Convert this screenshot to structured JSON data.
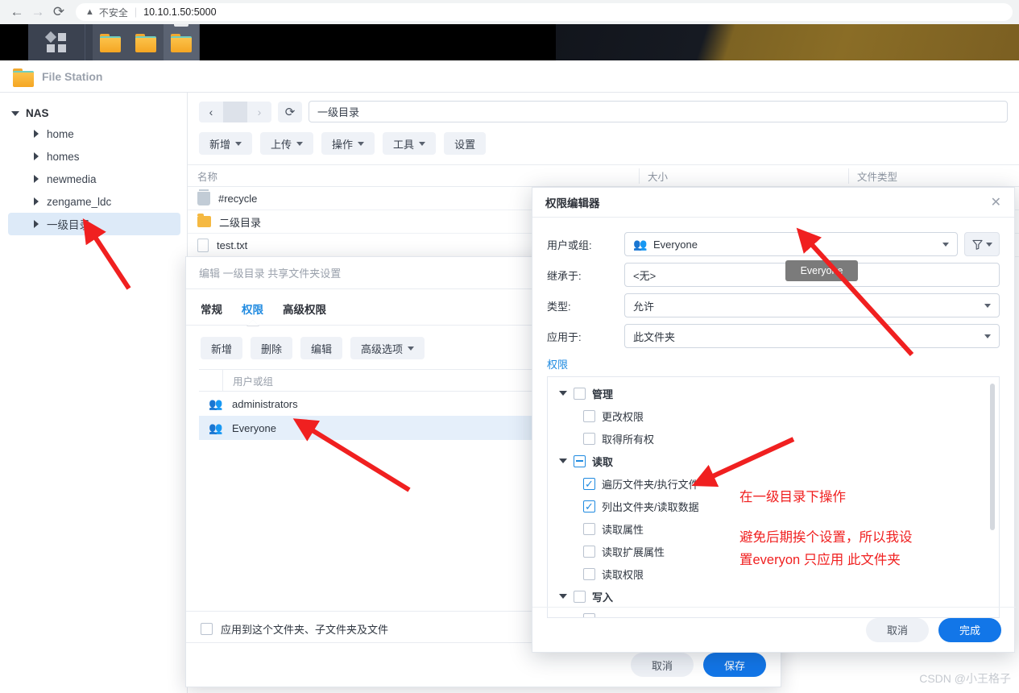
{
  "browser": {
    "back_icon": "arrow-left-icon",
    "forward_icon": "arrow-right-icon",
    "reload_icon": "reload-icon",
    "warning_icon": "warning-triangle-icon",
    "security_label": "不安全",
    "url": "10.10.1.50:5000"
  },
  "desktop": {
    "apps_icon": "app-grid-icon",
    "taskbar_items": [
      "folder-icon",
      "folder-icon",
      "folder-icon"
    ]
  },
  "file_station": {
    "title": "File Station",
    "folder_icon": "folder-icon",
    "sidebar": {
      "root": "NAS",
      "items": [
        {
          "label": "home",
          "selected": false
        },
        {
          "label": "homes",
          "selected": false
        },
        {
          "label": "newmedia",
          "selected": false
        },
        {
          "label": "zengame_ldc",
          "selected": false
        },
        {
          "label": "一级目录",
          "selected": true
        }
      ]
    },
    "nav": {
      "back_icon": "chevron-left-icon",
      "forward_icon": "chevron-right-icon",
      "refresh_icon": "refresh-icon",
      "path_value": "一级目录"
    },
    "toolbar": [
      {
        "label": "新增",
        "caret": true
      },
      {
        "label": "上传",
        "caret": true
      },
      {
        "label": "操作",
        "caret": true
      },
      {
        "label": "工具",
        "caret": true
      },
      {
        "label": "设置",
        "caret": false
      }
    ],
    "columns": [
      "名称",
      "大小",
      "文件类型"
    ],
    "rows": [
      {
        "icon": "trash-icon",
        "name": "#recycle"
      },
      {
        "icon": "folder-icon",
        "name": "二级目录"
      },
      {
        "icon": "file-icon",
        "name": "test.txt"
      }
    ]
  },
  "shared_folder_dialog": {
    "title": "编辑 一级目录 共享文件夹设置",
    "tabs": [
      {
        "label": "常规",
        "active": false
      },
      {
        "label": "权限",
        "active": true
      },
      {
        "label": "高级权限",
        "active": false
      }
    ],
    "buttons": [
      {
        "label": "新增",
        "caret": false
      },
      {
        "label": "删除",
        "caret": false
      },
      {
        "label": "编辑",
        "caret": false
      },
      {
        "label": "高级选项",
        "caret": true
      }
    ],
    "column_header": "用户或组",
    "users": [
      {
        "icon": "users-icon",
        "name": "administrators",
        "selected": false
      },
      {
        "icon": "users-icon",
        "name": "Everyone",
        "selected": true
      }
    ],
    "apply_checkbox_label": "应用到这个文件夹、子文件夹及文件",
    "apply_checkbox_checked": false,
    "cancel_label": "取消",
    "save_label": "保存"
  },
  "permission_editor": {
    "title": "权限编辑器",
    "close_icon": "close-icon",
    "fields": [
      {
        "label": "用户或组:",
        "value": "Everyone",
        "icon": "users-icon",
        "has_caret": true
      },
      {
        "label": "继承于:",
        "value": "<无>",
        "icon": "",
        "has_caret": false
      },
      {
        "label": "类型:",
        "value": "允许",
        "icon": "",
        "has_caret": true
      },
      {
        "label": "应用于:",
        "value": "此文件夹",
        "icon": "",
        "has_caret": true
      }
    ],
    "filter_icon": "filter-funnel-icon",
    "permissions_link": "权限",
    "tree": [
      {
        "level": 0,
        "label": "管理",
        "state": "unchecked",
        "expanded": true
      },
      {
        "level": 1,
        "label": "更改权限",
        "state": "unchecked"
      },
      {
        "level": 1,
        "label": "取得所有权",
        "state": "unchecked"
      },
      {
        "level": 0,
        "label": "读取",
        "state": "indeterminate",
        "expanded": true
      },
      {
        "level": 1,
        "label": "遍历文件夹/执行文件",
        "state": "checked"
      },
      {
        "level": 1,
        "label": "列出文件夹/读取数据",
        "state": "checked"
      },
      {
        "level": 1,
        "label": "读取属性",
        "state": "unchecked"
      },
      {
        "level": 1,
        "label": "读取扩展属性",
        "state": "unchecked"
      },
      {
        "level": 1,
        "label": "读取权限",
        "state": "unchecked"
      },
      {
        "level": 0,
        "label": "写入",
        "state": "unchecked",
        "expanded": true
      }
    ],
    "cancel_label": "取消",
    "confirm_label": "完成"
  },
  "tooltip": {
    "text": "Everyone"
  },
  "annotations": {
    "color": "#f02020",
    "note1": "在一级目录下操作",
    "note2_line1": "避免后期挨个设置，所以我设",
    "note2_line2": "置everyon 只应用 此文件夹"
  },
  "watermark": "CSDN @小王格子"
}
